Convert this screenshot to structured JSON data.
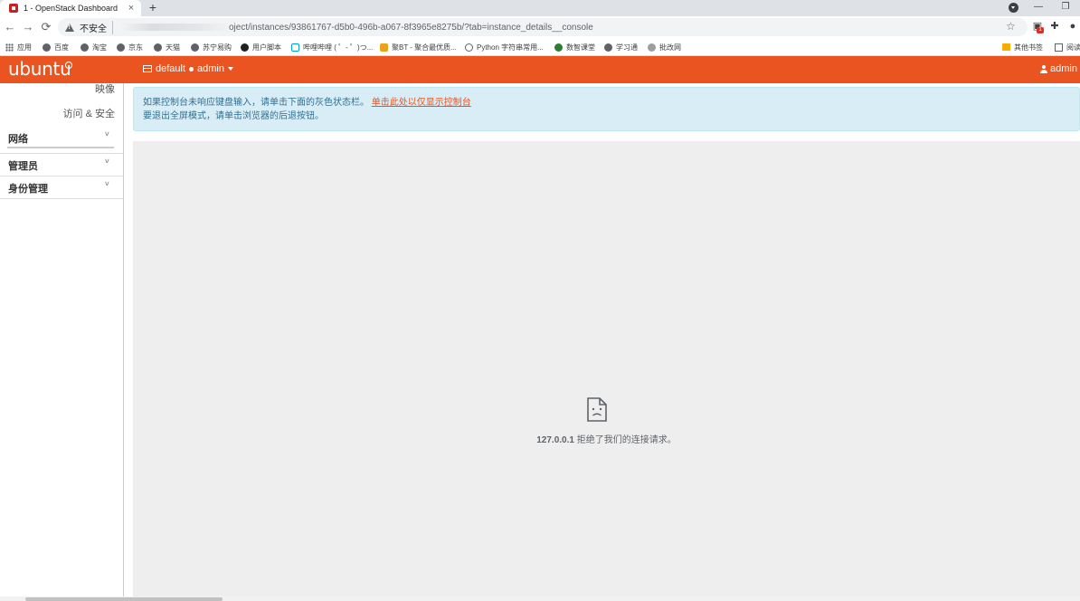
{
  "browser": {
    "tab": {
      "title": "1 - OpenStack Dashboard",
      "close": "×"
    },
    "new_tab": "+",
    "window_controls": {
      "minimize": "—",
      "restore": "❐"
    },
    "toolbar": {
      "back": "←",
      "forward": "→",
      "reload": "⟳",
      "security_label": "不安全",
      "url": "oject/instances/93861767-d5b0-496b-a067-8f3965e8275b/?tab=instance_details__console",
      "star": "☆"
    },
    "bookmarks": [
      {
        "label": "应用",
        "icon": "apps-grid-icon"
      },
      {
        "label": "百度",
        "icon": "globe-icon"
      },
      {
        "label": "淘宝",
        "icon": "globe-icon"
      },
      {
        "label": "京东",
        "icon": "globe-icon"
      },
      {
        "label": "天猫",
        "icon": "globe-icon"
      },
      {
        "label": "苏宁易购",
        "icon": "globe-icon"
      },
      {
        "label": "用户脚本",
        "icon": "script-icon"
      },
      {
        "label": "哔哩哔哩 ( ゜- ゜)つ...",
        "icon": "bilibili-icon"
      },
      {
        "label": "聚BT - 聚合最优质...",
        "icon": "bt-icon"
      },
      {
        "label": "Python 字符串常用...",
        "icon": "python-icon"
      },
      {
        "label": "数智课堂",
        "icon": "classroom-icon"
      },
      {
        "label": "学习通",
        "icon": "globe-icon"
      },
      {
        "label": "批改网",
        "icon": "pigai-icon"
      },
      {
        "label": "其他书签",
        "icon": "folder-icon"
      },
      {
        "label": "阅读",
        "icon": "reading-list-icon"
      }
    ]
  },
  "topnav": {
    "brand": "ubuntu",
    "project_domain": "default",
    "project_name": "admin",
    "user": "admin"
  },
  "sidebar": {
    "sub_items": [
      "映像",
      "访问 & 安全"
    ],
    "groups": [
      {
        "label": "网络"
      },
      {
        "label": "管理员"
      },
      {
        "label": "身份管理"
      }
    ],
    "chevron": "˅"
  },
  "main": {
    "alert": {
      "line1": "如果控制台未响应键盘输入，请单击下面的灰色状态栏。",
      "link": "单击此处以仅显示控制台",
      "line2": "要退出全屏模式，请单击浏览器的后退按钮。"
    },
    "console_error": {
      "host": "127.0.0.1",
      "message": "拒绝了我们的连接请求。"
    }
  }
}
